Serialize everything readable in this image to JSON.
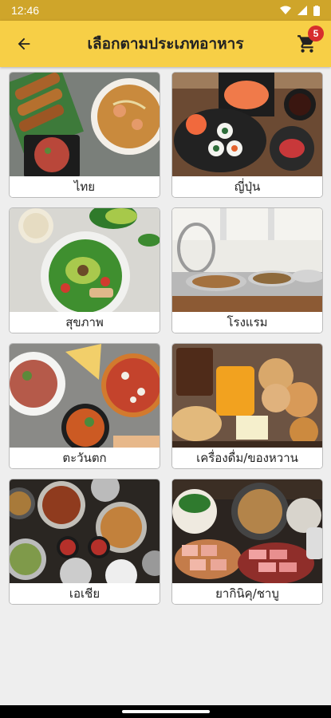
{
  "status_bar": {
    "time": "12:46"
  },
  "app_bar": {
    "title": "เลือกตามประเภทอาหาร",
    "cart_badge": "5",
    "back_icon": "arrow-left-icon",
    "cart_icon": "cart-icon"
  },
  "categories": [
    {
      "label": "ไทย"
    },
    {
      "label": "ญี่ปุ่น"
    },
    {
      "label": "สุขภาพ"
    },
    {
      "label": "โรงแรม"
    },
    {
      "label": "ตะวันตก"
    },
    {
      "label": "เครื่องดื่ม/ของหวาน"
    },
    {
      "label": "เอเชีย"
    },
    {
      "label": "ยากินิคุ/ชาบู"
    }
  ],
  "colors": {
    "status_bar": "#cfa52a",
    "app_bar": "#f7cf46",
    "badge": "#d72d2d",
    "background": "#eeeeee"
  }
}
